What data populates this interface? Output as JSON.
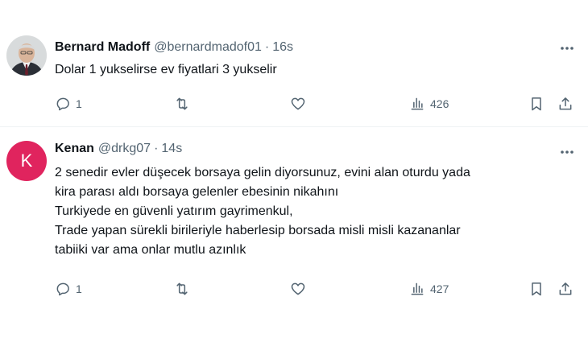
{
  "tweets": [
    {
      "display_name": "Bernard Madoff",
      "handle": "@bernardmadof01",
      "separator": "·",
      "time": "16s",
      "lines": [
        "Dolar 1 yukselirse ev fiyatlari 3 yukselir"
      ],
      "avatar": {
        "type": "photo"
      },
      "actions": {
        "replies": "1",
        "views": "426"
      }
    },
    {
      "display_name": "Kenan",
      "handle": "@drkg07",
      "separator": "·",
      "time": "14s",
      "lines": [
        "2 senedir evler düşecek borsaya gelin diyorsunuz, evini alan oturdu yada",
        "kira parası aldı borsaya gelenler ebesinin nikahını",
        "Turkiyede en güvenli yatırım gayrimenkul,",
        "Trade yapan sürekli birileriyle haberlesip borsada misli misli kazananlar",
        "tabiiki var ama onlar mutlu azınlık"
      ],
      "avatar": {
        "type": "letter",
        "letter": "K",
        "color": "#e0245e"
      },
      "actions": {
        "replies": "1",
        "views": "427"
      }
    }
  ],
  "icons": [
    "more-icon",
    "reply-icon",
    "retweet-icon",
    "like-icon",
    "views-icon",
    "bookmark-icon",
    "share-icon"
  ],
  "colors": {
    "text": "#0f1419",
    "secondary": "#536471",
    "divider": "#eff3f4",
    "avatar_k": "#e0245e"
  }
}
